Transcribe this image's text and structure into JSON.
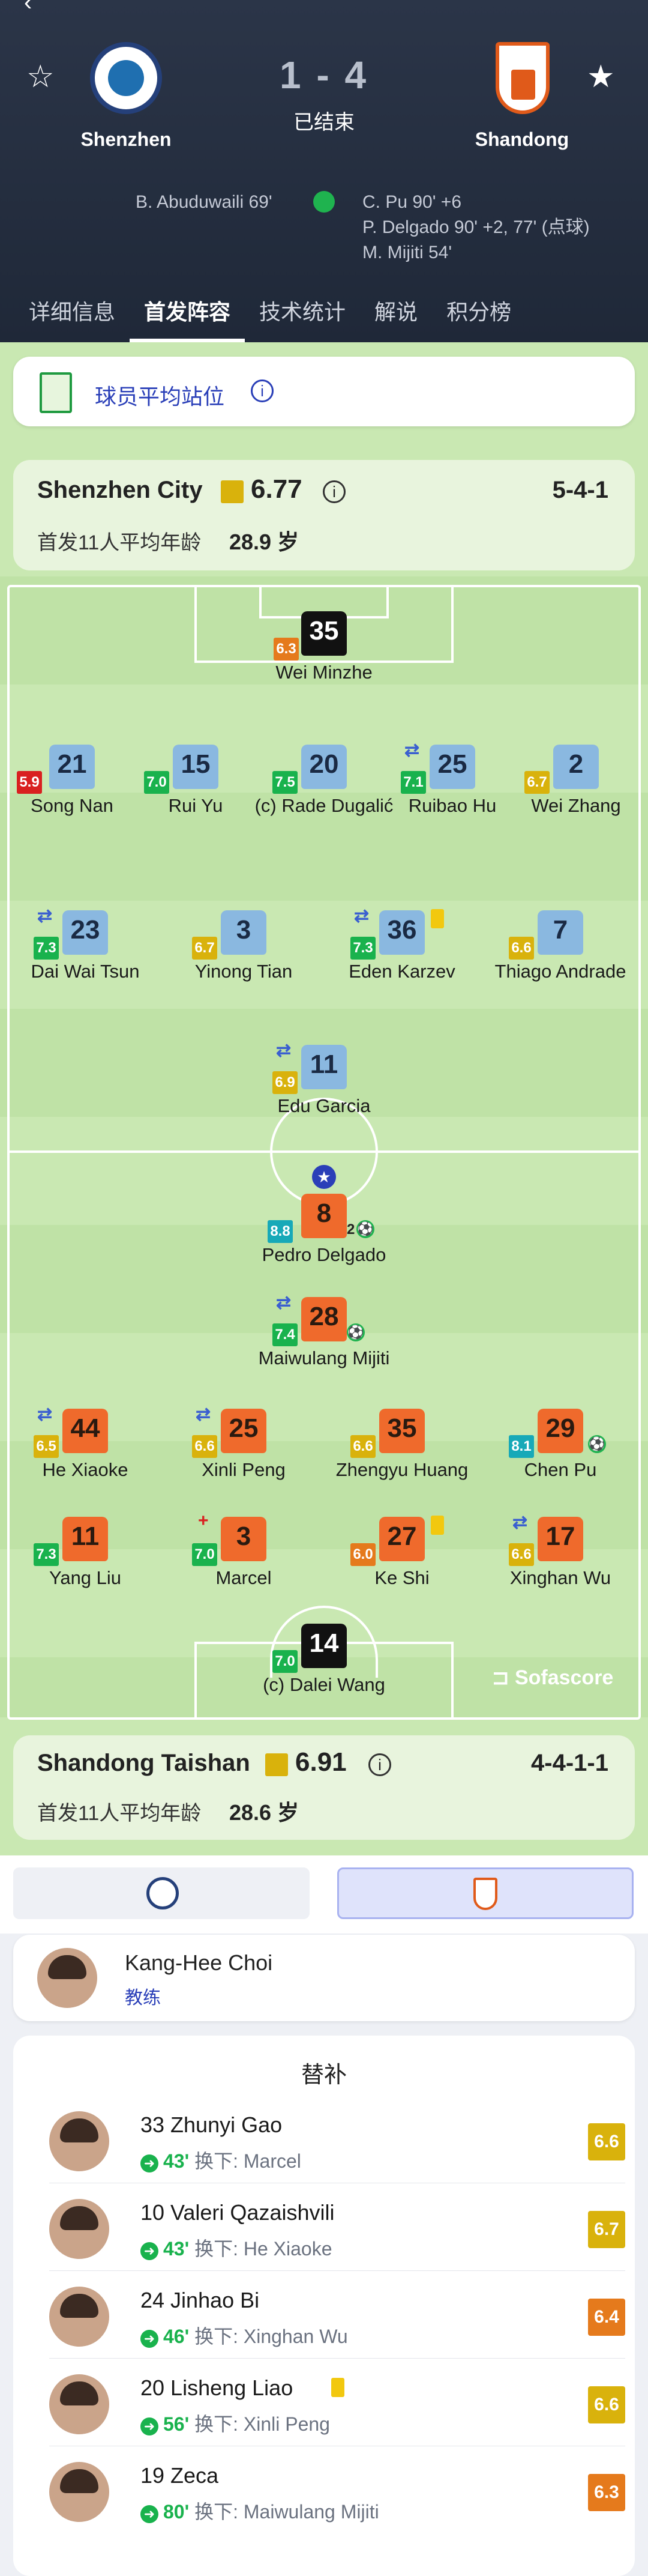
{
  "match": {
    "home_team": "Shenzhen",
    "away_team": "Shandong",
    "score": "1 - 4",
    "status": "已结束",
    "home_goals": [
      "B. Abuduwaili 69'"
    ],
    "away_goals": [
      "C. Pu 90' +6",
      "P. Delgado 90' +2, 77' (点球)",
      "M. Mijiti 54'"
    ]
  },
  "tabs": [
    "详细信息",
    "首发阵容",
    "技术统计",
    "解说",
    "积分榜"
  ],
  "avg_position_label": "球员平均站位",
  "home": {
    "name": "Shenzhen City",
    "rating": "6.77",
    "formation": "5-4-1",
    "avg_age_label": "首发11人平均年龄",
    "avg_age": "28.9 岁",
    "players": [
      {
        "num": "35",
        "name": "Wei Minzhe",
        "rating": "6.3"
      },
      {
        "num": "21",
        "name": "Song Nan",
        "rating": "5.9"
      },
      {
        "num": "15",
        "name": "Rui Yu",
        "rating": "7.0"
      },
      {
        "num": "20",
        "name": "(c) Rade Dugalić",
        "rating": "7.5"
      },
      {
        "num": "25",
        "name": "Ruibao Hu",
        "rating": "7.1"
      },
      {
        "num": "2",
        "name": "Wei Zhang",
        "rating": "6.7"
      },
      {
        "num": "23",
        "name": "Dai Wai Tsun",
        "rating": "7.3"
      },
      {
        "num": "3",
        "name": "Yinong Tian",
        "rating": "6.7"
      },
      {
        "num": "36",
        "name": "Eden Karzev",
        "rating": "7.3"
      },
      {
        "num": "7",
        "name": "Thiago Andrade",
        "rating": "6.6"
      },
      {
        "num": "11",
        "name": "Edu Garcia",
        "rating": "6.9"
      }
    ]
  },
  "away": {
    "name": "Shandong Taishan",
    "rating": "6.91",
    "formation": "4-4-1-1",
    "avg_age_label": "首发11人平均年龄",
    "avg_age": "28.6 岁",
    "players": [
      {
        "num": "8",
        "name": "Pedro Delgado",
        "rating": "8.8",
        "goals": "2"
      },
      {
        "num": "28",
        "name": "Maiwulang Mijiti",
        "rating": "7.4"
      },
      {
        "num": "44",
        "name": "He Xiaoke",
        "rating": "6.5"
      },
      {
        "num": "25",
        "name": "Xinli Peng",
        "rating": "6.6"
      },
      {
        "num": "35",
        "name": "Zhengyu Huang",
        "rating": "6.6"
      },
      {
        "num": "29",
        "name": "Chen Pu",
        "rating": "8.1"
      },
      {
        "num": "11",
        "name": "Yang Liu",
        "rating": "7.3"
      },
      {
        "num": "3",
        "name": "Marcel",
        "rating": "7.0"
      },
      {
        "num": "27",
        "name": "Ke Shi",
        "rating": "6.0"
      },
      {
        "num": "17",
        "name": "Xinghan Wu",
        "rating": "6.6"
      },
      {
        "num": "14",
        "name": "(c) Dalei Wang",
        "rating": "7.0"
      }
    ]
  },
  "watermark": "Sofascore",
  "coach": {
    "name": "Kang-Hee Choi",
    "role": "教练"
  },
  "subs_title": "替补",
  "subs": [
    {
      "num_name": "33 Zhunyi Gao",
      "minute": "43'",
      "text": "换下: Marcel",
      "rating": "6.6"
    },
    {
      "num_name": "10 Valeri Qazaishvili",
      "minute": "43'",
      "text": "换下: He Xiaoke",
      "rating": "6.7"
    },
    {
      "num_name": "24 Jinhao Bi",
      "minute": "46'",
      "text": "换下: Xinghan Wu",
      "rating": "6.4"
    },
    {
      "num_name": "20 Lisheng Liao",
      "minute": "56'",
      "text": "换下: Xinli Peng",
      "rating": "6.6"
    },
    {
      "num_name": "19 Zeca",
      "minute": "80'",
      "text": "换下: Maiwulang Mijiti",
      "rating": "6.3"
    }
  ],
  "colors": {
    "header": "#2b3548",
    "pitch": "#c9e8b2",
    "home_shirt": "#8ab8e0",
    "away_shirt": "#ef6a2c",
    "accent": "#2a3fb8"
  }
}
